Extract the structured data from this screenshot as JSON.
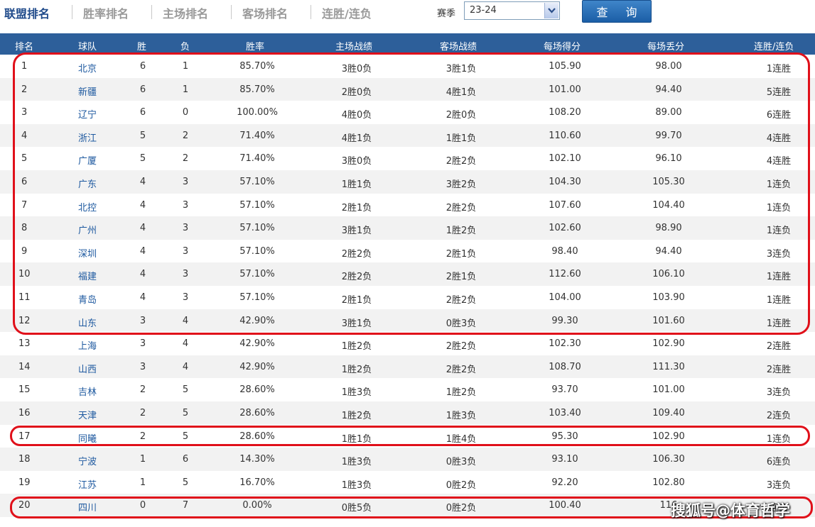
{
  "tabs": [
    {
      "label": "联盟排名",
      "active": true
    },
    {
      "label": "胜率排名",
      "active": false
    },
    {
      "label": "主场排名",
      "active": false
    },
    {
      "label": "客场排名",
      "active": false
    },
    {
      "label": "连胜/连负",
      "active": false
    }
  ],
  "filter": {
    "season_label": "赛季",
    "season_value": "23-24",
    "query_label": "查 询"
  },
  "table": {
    "headers": [
      "排名",
      "球队",
      "胜",
      "负",
      "胜率",
      "主场战绩",
      "客场战绩",
      "每场得分",
      "每场丢分",
      "连胜/连负"
    ],
    "rows": [
      [
        "1",
        "北京",
        "6",
        "1",
        "85.70%",
        "3胜0负",
        "3胜1负",
        "105.90",
        "98.00",
        "1连胜"
      ],
      [
        "2",
        "新疆",
        "6",
        "1",
        "85.70%",
        "2胜0负",
        "4胜1负",
        "101.00",
        "94.40",
        "5连胜"
      ],
      [
        "3",
        "辽宁",
        "6",
        "0",
        "100.00%",
        "4胜0负",
        "2胜0负",
        "108.20",
        "89.00",
        "6连胜"
      ],
      [
        "4",
        "浙江",
        "5",
        "2",
        "71.40%",
        "4胜1负",
        "1胜1负",
        "110.60",
        "99.70",
        "4连胜"
      ],
      [
        "5",
        "广厦",
        "5",
        "2",
        "71.40%",
        "3胜0负",
        "2胜2负",
        "102.10",
        "96.10",
        "4连胜"
      ],
      [
        "6",
        "广东",
        "4",
        "3",
        "57.10%",
        "1胜1负",
        "3胜2负",
        "104.30",
        "105.30",
        "1连负"
      ],
      [
        "7",
        "北控",
        "4",
        "3",
        "57.10%",
        "2胜1负",
        "2胜2负",
        "107.60",
        "104.40",
        "1连负"
      ],
      [
        "8",
        "广州",
        "4",
        "3",
        "57.10%",
        "3胜1负",
        "1胜2负",
        "102.60",
        "98.90",
        "1连负"
      ],
      [
        "9",
        "深圳",
        "4",
        "3",
        "57.10%",
        "2胜2负",
        "2胜1负",
        "98.40",
        "94.40",
        "3连负"
      ],
      [
        "10",
        "福建",
        "4",
        "3",
        "57.10%",
        "2胜2负",
        "2胜1负",
        "112.60",
        "106.10",
        "1连胜"
      ],
      [
        "11",
        "青岛",
        "4",
        "3",
        "57.10%",
        "2胜1负",
        "2胜2负",
        "104.00",
        "103.90",
        "1连胜"
      ],
      [
        "12",
        "山东",
        "3",
        "4",
        "42.90%",
        "3胜1负",
        "0胜3负",
        "99.30",
        "101.60",
        "1连胜"
      ],
      [
        "13",
        "上海",
        "3",
        "4",
        "42.90%",
        "1胜2负",
        "2胜2负",
        "102.30",
        "102.90",
        "2连胜"
      ],
      [
        "14",
        "山西",
        "3",
        "4",
        "42.90%",
        "1胜2负",
        "2胜2负",
        "108.70",
        "111.30",
        "2连胜"
      ],
      [
        "15",
        "吉林",
        "2",
        "5",
        "28.60%",
        "1胜3负",
        "1胜2负",
        "93.70",
        "101.00",
        "3连负"
      ],
      [
        "16",
        "天津",
        "2",
        "5",
        "28.60%",
        "1胜2负",
        "1胜3负",
        "103.40",
        "109.40",
        "2连负"
      ],
      [
        "17",
        "同曦",
        "2",
        "5",
        "28.60%",
        "1胜1负",
        "1胜4负",
        "95.30",
        "102.90",
        "1连负"
      ],
      [
        "18",
        "宁波",
        "1",
        "6",
        "14.30%",
        "1胜3负",
        "0胜3负",
        "93.10",
        "106.30",
        "6连负"
      ],
      [
        "19",
        "江苏",
        "1",
        "5",
        "16.70%",
        "1胜3负",
        "0胜2负",
        "92.20",
        "102.80",
        "3连负"
      ],
      [
        "20",
        "四川",
        "0",
        "7",
        "0.00%",
        "0胜5负",
        "0胜2负",
        "100.40",
        "116",
        "连负"
      ]
    ]
  },
  "watermark": "搜狐号@体育哲学",
  "colors": {
    "header_bg": "#2d5f9a",
    "team_link": "#1f5aa0",
    "highlight": "#e0101a",
    "active_tab": "#1f4a8a"
  }
}
